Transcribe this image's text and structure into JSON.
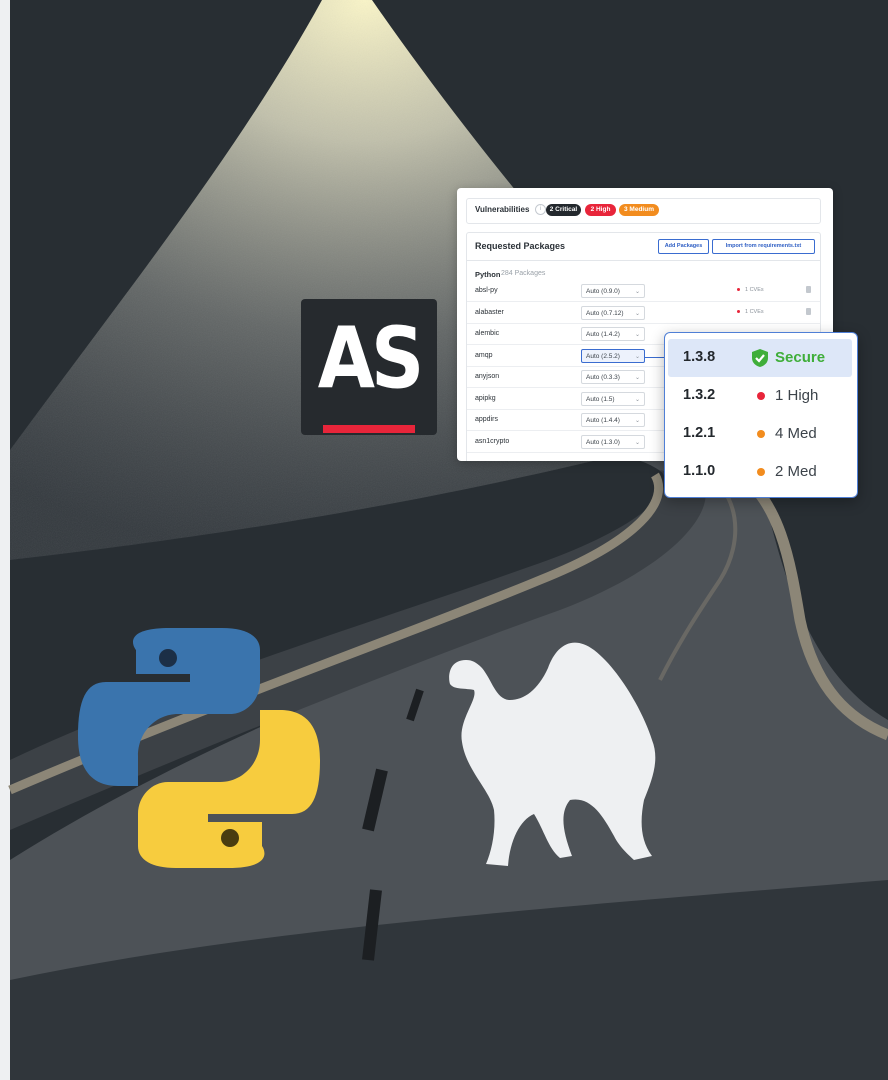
{
  "logo": {
    "text": "AS"
  },
  "panel": {
    "vulnerabilities": {
      "label": "Vulnerabilities",
      "info_icon": "info-icon",
      "badges": {
        "critical": "2 Critical",
        "high": "2 High",
        "medium": "3 Medium"
      }
    },
    "requested": {
      "title": "Requested Packages",
      "add_button": "Add Packages",
      "import_button": "Import from requirements.txt",
      "language": "Python",
      "count": "284 Packages"
    },
    "rows": [
      {
        "name": "absl-py",
        "version": "Auto (0.9.0)",
        "cves": "1 CVEs"
      },
      {
        "name": "alabaster",
        "version": "Auto (0.7.12)",
        "cves": "1 CVEs"
      },
      {
        "name": "alembic",
        "version": "Auto (1.4.2)",
        "cves": ""
      },
      {
        "name": "amqp",
        "version": "Auto (2.5.2)",
        "cves": ""
      },
      {
        "name": "anyjson",
        "version": "Auto (0.3.3)",
        "cves": ""
      },
      {
        "name": "apipkg",
        "version": "Auto (1.5)",
        "cves": ""
      },
      {
        "name": "appdirs",
        "version": "Auto (1.4.4)",
        "cves": ""
      },
      {
        "name": "asn1crypto",
        "version": "Auto (1.3.0)",
        "cves": ""
      }
    ]
  },
  "dropdown": {
    "options": [
      {
        "version": "1.3.8",
        "status": "Secure",
        "icon": "shield-check-icon",
        "color": "#3fae3a"
      },
      {
        "version": "1.3.2",
        "status": "1 High",
        "color": "#e8253a"
      },
      {
        "version": "1.2.1",
        "status": "4 Med",
        "color": "#f28c1e"
      },
      {
        "version": "1.1.0",
        "status": "2 Med",
        "color": "#f28c1e"
      }
    ]
  },
  "colors": {
    "background": "#282e33",
    "road": "#4d5257",
    "road_edge": "#8c8677",
    "spotlight": "#f3f0c8",
    "python_blue": "#3a74ad",
    "python_yellow": "#f7cc3e",
    "camel": "#eef0f2",
    "accent_red": "#e8253a"
  }
}
